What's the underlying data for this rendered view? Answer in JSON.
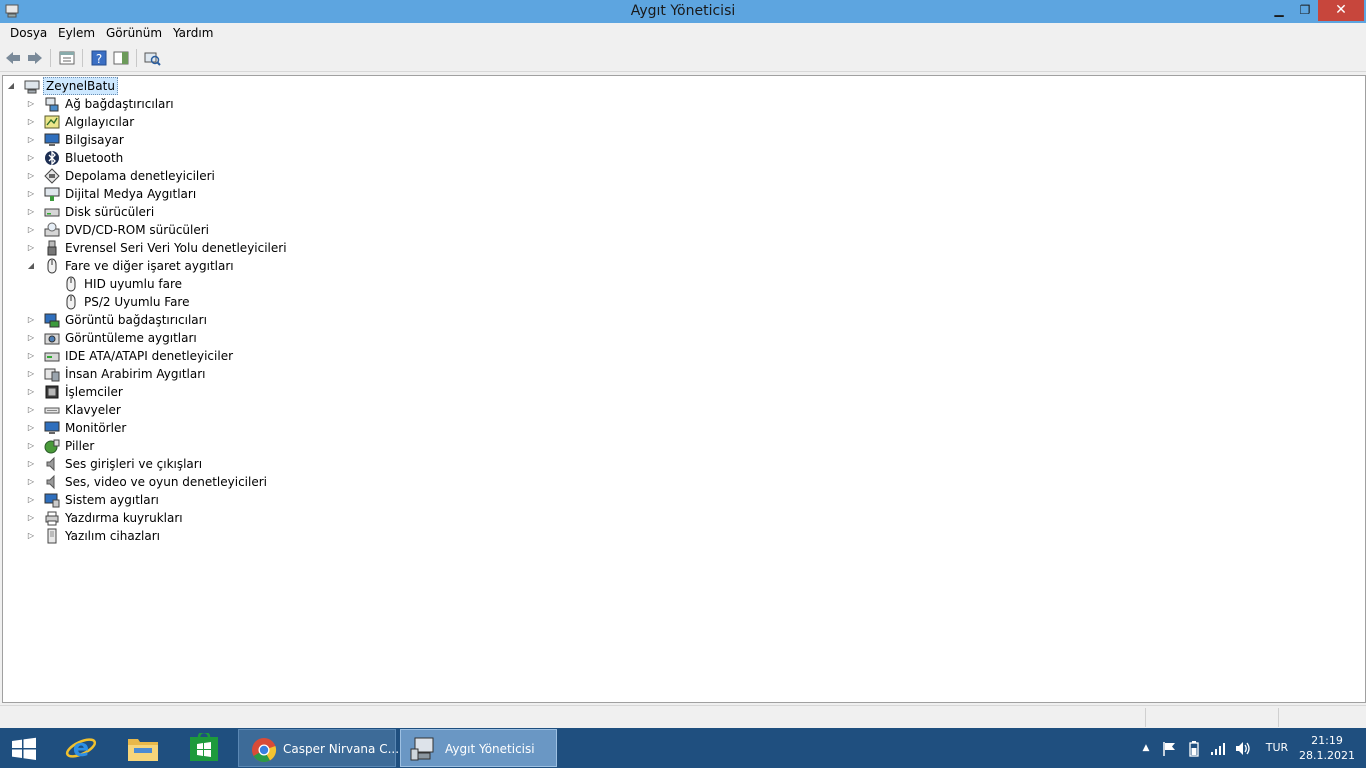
{
  "window": {
    "title": "Aygıt Yöneticisi",
    "close_glyph": "✕",
    "minimize_glyph": "▁",
    "maximize_glyph": "❐"
  },
  "menu": [
    "Dosya",
    "Eylem",
    "Görünüm",
    "Yardım"
  ],
  "toolbar": {
    "buttons": [
      "back-arrow-icon",
      "forward-arrow-icon",
      "properties-icon",
      "help-icon",
      "action-pane-icon",
      "scan-hardware-icon"
    ]
  },
  "tree": {
    "root": {
      "label": "ZeynelBatu",
      "icon": "computer-icon",
      "expanded": true
    },
    "categories": [
      {
        "label": "Ağ bağdaştırıcıları",
        "icon": "network-adapter-icon",
        "expanded": false
      },
      {
        "label": "Algılayıcılar",
        "icon": "sensor-icon",
        "expanded": false
      },
      {
        "label": "Bilgisayar",
        "icon": "computer-monitor-icon",
        "expanded": false
      },
      {
        "label": "Bluetooth",
        "icon": "bluetooth-icon",
        "expanded": false
      },
      {
        "label": "Depolama denetleyicileri",
        "icon": "storage-controller-icon",
        "expanded": false
      },
      {
        "label": "Dijital Medya Aygıtları",
        "icon": "media-device-icon",
        "expanded": false
      },
      {
        "label": "Disk sürücüleri",
        "icon": "disk-drive-icon",
        "expanded": false
      },
      {
        "label": "DVD/CD-ROM sürücüleri",
        "icon": "dvd-drive-icon",
        "expanded": false
      },
      {
        "label": "Evrensel Seri Veri Yolu denetleyicileri",
        "icon": "usb-icon",
        "expanded": false
      },
      {
        "label": "Fare ve diğer işaret aygıtları",
        "icon": "mouse-icon",
        "expanded": true,
        "children": [
          {
            "label": "HID uyumlu fare",
            "icon": "mouse-icon"
          },
          {
            "label": "PS/2 Uyumlu Fare",
            "icon": "mouse-icon"
          }
        ]
      },
      {
        "label": "Görüntü bağdaştırıcıları",
        "icon": "display-adapter-icon",
        "expanded": false
      },
      {
        "label": "Görüntüleme aygıtları",
        "icon": "camera-icon",
        "expanded": false
      },
      {
        "label": "IDE ATA/ATAPI denetleyiciler",
        "icon": "ide-controller-icon",
        "expanded": false
      },
      {
        "label": "İnsan Arabirim Aygıtları",
        "icon": "hid-icon",
        "expanded": false
      },
      {
        "label": "İşlemciler",
        "icon": "processor-icon",
        "expanded": false
      },
      {
        "label": "Klavyeler",
        "icon": "keyboard-icon",
        "expanded": false
      },
      {
        "label": "Monitörler",
        "icon": "monitor-icon",
        "expanded": false
      },
      {
        "label": "Piller",
        "icon": "battery-icon",
        "expanded": false
      },
      {
        "label": "Ses girişleri ve çıkışları",
        "icon": "speaker-icon",
        "expanded": false
      },
      {
        "label": "Ses, video ve oyun denetleyicileri",
        "icon": "speaker-icon",
        "expanded": false
      },
      {
        "label": "Sistem aygıtları",
        "icon": "system-device-icon",
        "expanded": false
      },
      {
        "label": "Yazdırma kuyrukları",
        "icon": "printer-icon",
        "expanded": false
      },
      {
        "label": "Yazılım cihazları",
        "icon": "software-device-icon",
        "expanded": false
      }
    ]
  },
  "taskbar": {
    "pinned": [
      "start-icon",
      "internet-explorer-icon",
      "file-explorer-icon",
      "store-icon"
    ],
    "tasks": [
      {
        "label": "Casper Nirvana C...",
        "icon": "chrome-icon",
        "active": false
      },
      {
        "label": "Aygıt Yöneticisi",
        "icon": "device-manager-icon",
        "active": true
      }
    ],
    "tray": {
      "chevron": "▲",
      "language": "TUR",
      "time": "21:19",
      "date": "28.1.2021"
    }
  },
  "colors": {
    "titlebar": "#5da5e0",
    "close_button": "#c7463c",
    "taskbar": "#1f4f7f",
    "selection": "#cde8ff"
  }
}
